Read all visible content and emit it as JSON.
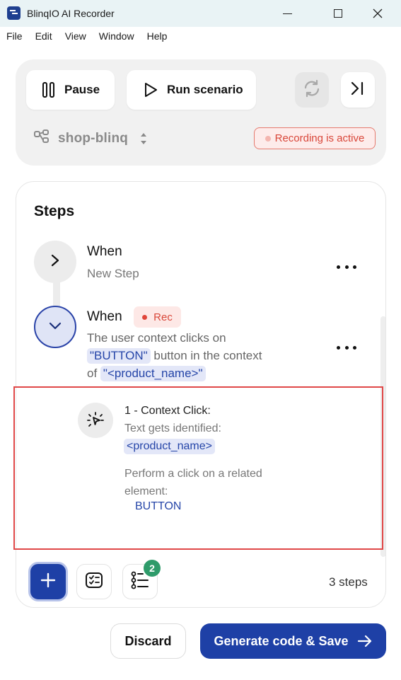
{
  "window": {
    "title": "BlinqIO AI Recorder",
    "minimize_icon": "minimize-icon",
    "maximize_icon": "maximize-icon",
    "close_icon": "close-icon"
  },
  "menu": [
    "File",
    "Edit",
    "View",
    "Window",
    "Help"
  ],
  "controls": {
    "pause_label": "Pause",
    "run_label": "Run scenario",
    "project_name": "shop-blinq",
    "recording_status": "Recording is active"
  },
  "steps": {
    "title": "Steps",
    "items": [
      {
        "keyword": "When",
        "text": "New Step"
      },
      {
        "keyword": "When",
        "badge": "Rec",
        "desc_part1": "The user context clicks on",
        "tag1": "\"BUTTON\"",
        "desc_part2": " button in the context",
        "desc_part3": "of ",
        "tag2": "\"<product_name>\""
      }
    ],
    "action": {
      "title": "1 - Context Click:",
      "text1": "Text gets identified:",
      "tag": "<product_name>",
      "text2": "Perform a click on a related element:",
      "target": "BUTTON"
    },
    "tool_badge_count": "2",
    "count_label": "3 steps"
  },
  "footer": {
    "discard_label": "Discard",
    "generate_label": "Generate code & Save"
  },
  "colors": {
    "primary": "#1e40a6",
    "recording_red": "#d9473a",
    "badge_green": "#2e9b6a"
  }
}
